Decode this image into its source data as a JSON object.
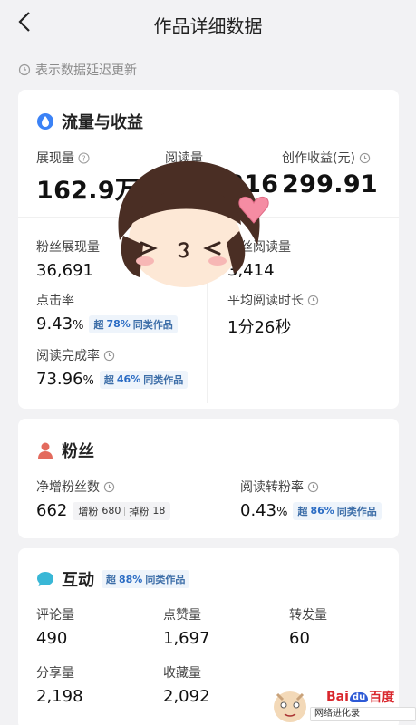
{
  "header": {
    "title": "作品详细数据"
  },
  "notice": "表示数据延迟更新",
  "traffic": {
    "title": "流量与收益",
    "impressions": {
      "label": "展现量",
      "value": "162.9万"
    },
    "reads": {
      "label": "阅读量",
      "value": "816"
    },
    "earnings": {
      "label": "创作收益(元)",
      "value": "299.91"
    },
    "fan_impressions": {
      "label": "粉丝展现量",
      "value": "36,691"
    },
    "fan_reads": {
      "label": "粉丝阅读量",
      "value": "3,414"
    },
    "ctr": {
      "label": "点击率",
      "value": "9.43",
      "unit": "%",
      "badge_prefix": "超",
      "badge_pct": "78%",
      "badge_suffix": "同类作品"
    },
    "avg_read_time": {
      "label": "平均阅读时长",
      "value": "1分26秒"
    },
    "completion": {
      "label": "阅读完成率",
      "value": "73.96",
      "unit": "%",
      "badge_prefix": "超",
      "badge_pct": "46%",
      "badge_suffix": "同类作品"
    }
  },
  "fans": {
    "title": "粉丝",
    "net_gain": {
      "label": "净增粉丝数",
      "value": "662",
      "gain_label": "增粉",
      "gain": "680",
      "loss_label": "掉粉",
      "loss": "18"
    },
    "conversion": {
      "label": "阅读转粉率",
      "value": "0.43",
      "unit": "%",
      "badge_prefix": "超",
      "badge_pct": "86%",
      "badge_suffix": "同类作品"
    }
  },
  "interaction": {
    "title": "互动",
    "badge_prefix": "超",
    "badge_pct": "88%",
    "badge_suffix": "同类作品",
    "comments": {
      "label": "评论量",
      "value": "490"
    },
    "likes": {
      "label": "点赞量",
      "value": "1,697"
    },
    "shares_fwd": {
      "label": "转发量",
      "value": "60"
    },
    "shares": {
      "label": "分享量",
      "value": "2,198"
    },
    "favorites": {
      "label": "收藏量",
      "value": "2,092"
    }
  },
  "watermark": {
    "brand_a": "Bai",
    "brand_du": "du",
    "brand_b": "百度",
    "text": "网络进化录"
  },
  "colors": {
    "accent": "#2b6cc4",
    "badge_bg": "#eef4fb",
    "fans_icon": "#e36a5d",
    "interaction_icon": "#39b7d6",
    "traffic_icon": "#3b82f6"
  },
  "icons": [
    "back-arrow-icon",
    "clock-icon",
    "drop-icon",
    "question-icon",
    "user-icon",
    "chat-bubble-icon"
  ]
}
